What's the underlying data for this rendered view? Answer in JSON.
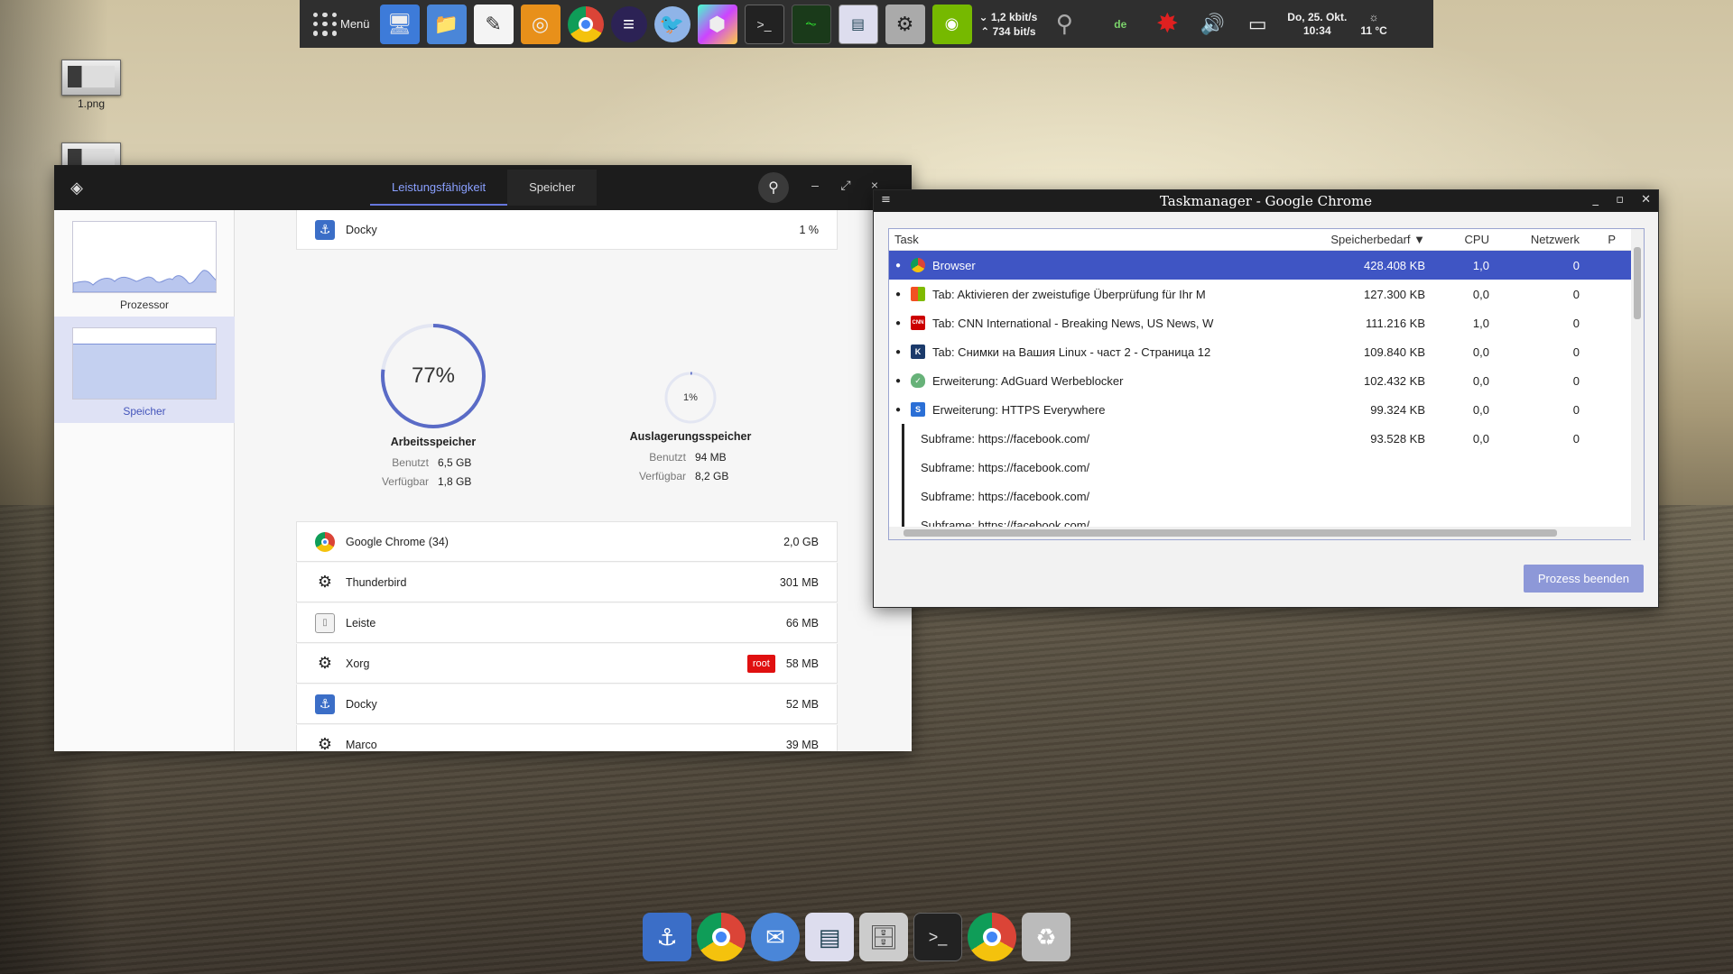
{
  "top_panel": {
    "menu_label": "Menü",
    "net_down": "1,2 kbit/s",
    "net_up": "734 bit/s",
    "lang": "de",
    "date": "Do, 25. Okt.",
    "time": "10:34",
    "temp": "11 °C",
    "launchers": [
      "computer-icon",
      "folder-icon",
      "text-editor-icon",
      "xnview-icon",
      "chrome-icon",
      "eclipse-icon",
      "thunderbird-icon",
      "cube-icon",
      "terminal-icon",
      "system-monitor-icon",
      "network-monitor-icon",
      "settings-icon",
      "nvidia-icon"
    ]
  },
  "desktop": {
    "icon1_label": "1.png"
  },
  "system_monitor": {
    "tabs": [
      "Leistungsfähigkeit",
      "Speicher"
    ],
    "active_tab": "Leistungsfähigkeit",
    "sidebar": {
      "processor_label": "Prozessor",
      "memory_label": "Speicher"
    },
    "top_row": {
      "name": "Docky",
      "value": "1 %"
    },
    "ram": {
      "percent": 77,
      "percent_label": "77%",
      "title": "Arbeitsspeicher",
      "used_label": "Benutzt",
      "used_value": "6,5 GB",
      "free_label": "Verfügbar",
      "free_value": "1,8 GB"
    },
    "swap": {
      "percent": 1,
      "percent_label": "1%",
      "title": "Auslagerungsspeicher",
      "used_label": "Benutzt",
      "used_value": "94 MB",
      "free_label": "Verfügbar",
      "free_value": "8,2 GB"
    },
    "processes": [
      {
        "name": "Google Chrome (34)",
        "value": "2,0 GB",
        "badge": ""
      },
      {
        "name": "Thunderbird",
        "value": "301 MB",
        "badge": ""
      },
      {
        "name": "Leiste",
        "value": "66 MB",
        "badge": ""
      },
      {
        "name": "Xorg",
        "value": "58 MB",
        "badge": "root"
      },
      {
        "name": "Docky",
        "value": "52 MB",
        "badge": ""
      },
      {
        "name": "Marco",
        "value": "39 MB",
        "badge": ""
      }
    ]
  },
  "task_manager": {
    "title": "Taskmanager - Google Chrome",
    "columns": {
      "task": "Task",
      "memory": "Speicherbedarf ▼",
      "cpu": "CPU",
      "network": "Netzwerk",
      "p": "P"
    },
    "rows": [
      {
        "task": "Browser",
        "memory": "428.408 KB",
        "cpu": "1,0",
        "network": "0",
        "icon": "chrome",
        "bullet": true
      },
      {
        "task": "Tab: Aktivieren der zweistufige Überprüfung für Ihr M",
        "memory": "127.300 KB",
        "cpu": "0,0",
        "network": "0",
        "icon": "microsoft",
        "bullet": true
      },
      {
        "task": "Tab: CNN International - Breaking News, US News, W",
        "memory": "111.216 KB",
        "cpu": "1,0",
        "network": "0",
        "icon": "cnn",
        "bullet": true
      },
      {
        "task": "Tab: Снимки на Вашия Linux - част 2 - Страница 12",
        "memory": "109.840 KB",
        "cpu": "0,0",
        "network": "0",
        "icon": "k",
        "bullet": true
      },
      {
        "task": "Erweiterung: AdGuard Werbeblocker",
        "memory": "102.432 KB",
        "cpu": "0,0",
        "network": "0",
        "icon": "adguard",
        "bullet": true
      },
      {
        "task": "Erweiterung: HTTPS Everywhere",
        "memory": "99.324 KB",
        "cpu": "0,0",
        "network": "0",
        "icon": "https",
        "bullet": true
      },
      {
        "task": "Subframe: https://facebook.com/",
        "memory": "93.528 KB",
        "cpu": "0,0",
        "network": "0",
        "icon": "",
        "bullet": false
      },
      {
        "task": "Subframe: https://facebook.com/",
        "memory": "",
        "cpu": "",
        "network": "",
        "icon": "",
        "bullet": false
      },
      {
        "task": "Subframe: https://facebook.com/",
        "memory": "",
        "cpu": "",
        "network": "",
        "icon": "",
        "bullet": false
      },
      {
        "task": "Subframe: https://facebook.com/",
        "memory": "",
        "cpu": "",
        "network": "",
        "icon": "",
        "bullet": false
      }
    ],
    "end_button": "Prozess beenden"
  },
  "dock": {
    "items": [
      "docky-anchor-icon",
      "chrome-icon",
      "thunderbird-icon",
      "system-monitor-icon",
      "files-icon",
      "terminal-icon",
      "chrome-icon",
      "trash-icon"
    ]
  }
}
